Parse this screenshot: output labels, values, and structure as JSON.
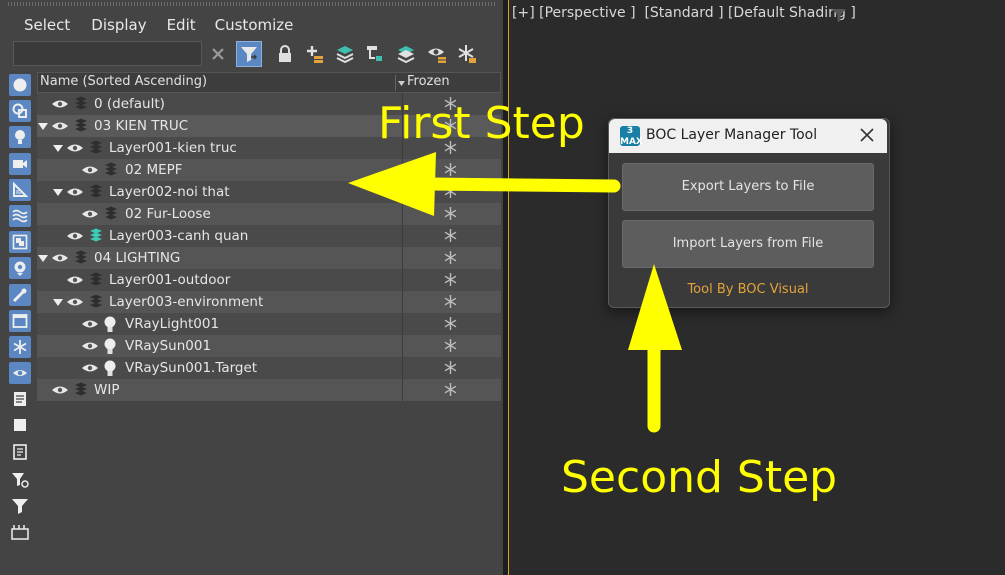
{
  "menu": [
    "Select",
    "Display",
    "Edit",
    "Customize"
  ],
  "search": {
    "value": ""
  },
  "tree": {
    "header_name": "Name (Sorted Ascending)",
    "header_frozen": "Frozen",
    "rows": [
      {
        "label": "0 (default)",
        "icon": "layer-stack-icon"
      },
      {
        "label": "03 KIEN TRUC",
        "icon": "layer-stack-icon",
        "expanded": true
      },
      {
        "label": "Layer001-kien truc",
        "icon": "layer-stack-icon",
        "expanded": true
      },
      {
        "label": "02 MEPF",
        "icon": "layer-stack-icon"
      },
      {
        "label": "Layer002-noi that",
        "icon": "layer-stack-icon",
        "expanded": true
      },
      {
        "label": "02 Fur-Loose",
        "icon": "layer-stack-icon"
      },
      {
        "label": "Layer003-canh quan",
        "icon": "layer-stack-active-icon"
      },
      {
        "label": "04 LIGHTING",
        "icon": "layer-stack-icon",
        "expanded": true
      },
      {
        "label": "Layer001-outdoor",
        "icon": "layer-stack-icon"
      },
      {
        "label": "Layer003-environment",
        "icon": "layer-stack-icon",
        "expanded": true
      },
      {
        "label": "VRayLight001",
        "icon": "light-bulb-icon"
      },
      {
        "label": "VRaySun001",
        "icon": "light-bulb-icon"
      },
      {
        "label": "VRaySun001.Target",
        "icon": "light-bulb-icon"
      },
      {
        "label": "WIP",
        "icon": "layer-stack-icon"
      }
    ]
  },
  "viewport": {
    "label": "[+] [Perspective ]  [Standard ] [Default Shading ]"
  },
  "dialog": {
    "title": "BOC Layer Manager Tool",
    "logo": "3 MAX",
    "export_label": "Export Layers to File",
    "import_label": "Import Layers from File",
    "credit": "Tool By BOC Visual",
    "credit_color": "#e3a33a"
  },
  "annotations": {
    "first": "First Step",
    "second": "Second Step",
    "color": "#ffff00"
  },
  "colors": {
    "accent": "#5b87c2",
    "viewport_border": "#d6a227"
  }
}
